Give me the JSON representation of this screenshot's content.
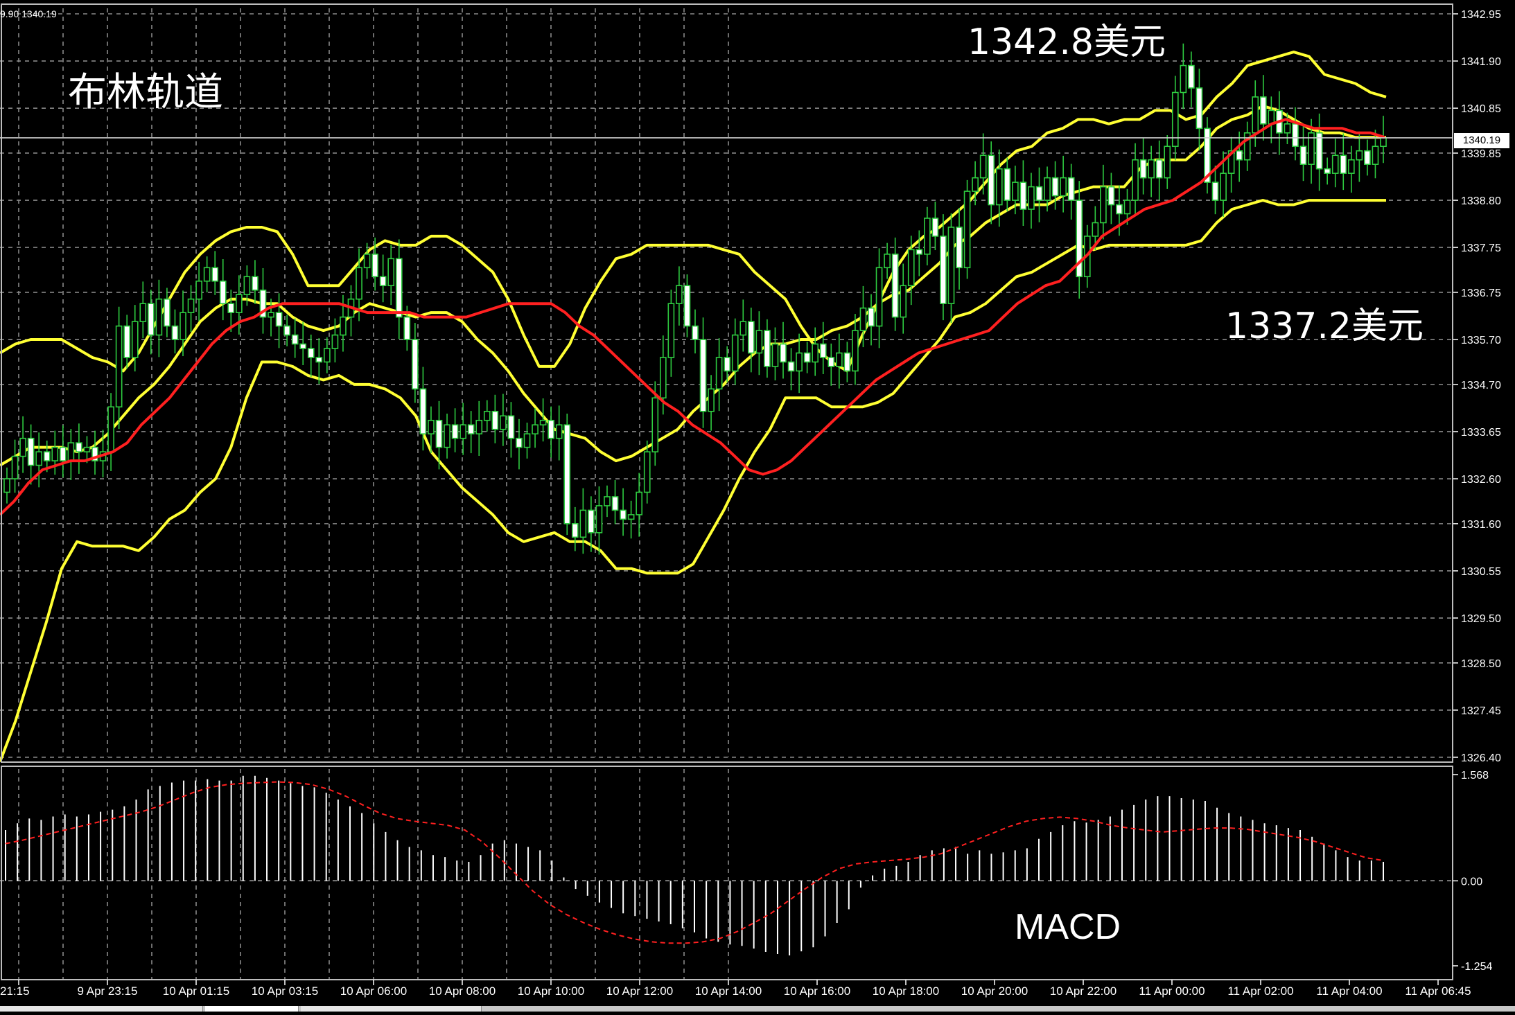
{
  "title": "布林轨道",
  "ohlc_readout": "9.90 1340.19",
  "annotations": {
    "high": "1342.8美元",
    "low": "1337.2美元",
    "macd": "MACD"
  },
  "current_price_label": "1340.19",
  "colors": {
    "background": "#000000",
    "grid": "#8a8a8a",
    "bullish": "#2ecc40",
    "bearish": "#ffffff",
    "band": "#ffff33",
    "ma": "#ff2020",
    "macd_signal": "#ff2020",
    "macd_hist": "#ffffff"
  },
  "chart_data": [
    {
      "type": "candlestick",
      "title": "布林轨道",
      "x_ticks": [
        "21:15",
        "9 Apr 23:15",
        "10 Apr 01:15",
        "10 Apr 03:15",
        "10 Apr 06:00",
        "10 Apr 08:00",
        "10 Apr 10:00",
        "10 Apr 12:00",
        "10 Apr 14:00",
        "10 Apr 16:00",
        "10 Apr 18:00",
        "10 Apr 20:00",
        "10 Apr 22:00",
        "11 Apr 00:00",
        "11 Apr 02:00",
        "11 Apr 04:00",
        "11 Apr 06:45"
      ],
      "y_ticks": [
        "1342.95",
        "1341.90",
        "1340.85",
        "1339.85",
        "1338.80",
        "1337.75",
        "1336.75",
        "1335.70",
        "1334.70",
        "1333.65",
        "1332.60",
        "1331.60",
        "1330.55",
        "1329.50",
        "1328.50",
        "1327.45",
        "1326.40"
      ],
      "ylim": [
        1326.4,
        1342.95
      ],
      "current_price": 1340.19,
      "closes": [
        1332.6,
        1333.1,
        1333.5,
        1332.9,
        1333.2,
        1333.0,
        1333.3,
        1333.0,
        1333.4,
        1333.2,
        1333.3,
        1333.0,
        1333.2,
        1334.2,
        1336.0,
        1335.3,
        1336.1,
        1336.5,
        1335.8,
        1336.6,
        1336.0,
        1335.7,
        1336.3,
        1336.6,
        1337.0,
        1337.3,
        1337.0,
        1336.5,
        1336.3,
        1336.7,
        1337.1,
        1336.8,
        1336.2,
        1336.3,
        1336.0,
        1335.8,
        1335.6,
        1335.5,
        1335.3,
        1335.2,
        1335.5,
        1335.8,
        1336.2,
        1336.6,
        1337.3,
        1337.6,
        1337.1,
        1336.9,
        1337.5,
        1336.2,
        1335.7,
        1334.6,
        1333.6,
        1333.9,
        1333.3,
        1333.8,
        1333.5,
        1333.8,
        1333.6,
        1333.9,
        1334.1,
        1333.7,
        1334.0,
        1333.5,
        1333.3,
        1333.6,
        1333.8,
        1333.9,
        1333.5,
        1333.8,
        1331.6,
        1331.3,
        1331.9,
        1331.4,
        1332.0,
        1332.2,
        1331.9,
        1331.7,
        1331.8,
        1332.3,
        1333.2,
        1334.4,
        1335.3,
        1336.5,
        1336.9,
        1336.0,
        1335.7,
        1334.1,
        1334.6,
        1335.3,
        1335.0,
        1335.8,
        1336.1,
        1335.4,
        1335.9,
        1335.1,
        1335.6,
        1335.2,
        1335.0,
        1335.4,
        1335.2,
        1335.6,
        1335.3,
        1335.1,
        1335.4,
        1335.0,
        1335.9,
        1336.4,
        1336.0,
        1337.3,
        1337.6,
        1336.2,
        1336.9,
        1337.7,
        1337.6,
        1338.4,
        1338.0,
        1336.5,
        1338.2,
        1337.3,
        1339.0,
        1339.3,
        1339.8,
        1338.7,
        1339.5,
        1338.8,
        1339.2,
        1338.6,
        1339.1,
        1338.8,
        1339.3,
        1338.9,
        1339.3,
        1338.8,
        1337.1,
        1338.0,
        1338.3,
        1339.1,
        1338.7,
        1338.5,
        1338.8,
        1339.7,
        1339.3,
        1339.7,
        1339.3,
        1340.0,
        1341.2,
        1341.8,
        1341.3,
        1340.4,
        1339.2,
        1338.8,
        1339.4,
        1339.9,
        1339.7,
        1340.3,
        1341.1,
        1340.5,
        1340.8,
        1340.3,
        1340.5,
        1340.0,
        1339.6,
        1340.3,
        1339.5,
        1339.4,
        1339.8,
        1339.4,
        1339.7,
        1339.9,
        1339.6,
        1340.0,
        1340.19
      ],
      "bands": {
        "upper": [
          1335.4,
          1335.6,
          1335.7,
          1335.7,
          1335.7,
          1335.5,
          1335.3,
          1335.2,
          1335.0,
          1335.4,
          1336.0,
          1336.6,
          1337.2,
          1337.6,
          1337.9,
          1338.1,
          1338.2,
          1338.2,
          1338.1,
          1337.6,
          1336.9,
          1336.9,
          1336.9,
          1337.3,
          1337.7,
          1337.9,
          1337.8,
          1337.8,
          1338.0,
          1338.0,
          1337.8,
          1337.5,
          1337.2,
          1336.6,
          1335.8,
          1335.1,
          1335.1,
          1335.6,
          1336.4,
          1337.0,
          1337.5,
          1337.6,
          1337.8,
          1337.8,
          1337.8,
          1337.8,
          1337.8,
          1337.7,
          1337.6,
          1337.2,
          1336.9,
          1336.6,
          1336.0,
          1335.5,
          1335.2,
          1335.0,
          1335.8,
          1336.5,
          1337.2,
          1337.7,
          1338.0,
          1338.2,
          1338.5,
          1338.8,
          1339.2,
          1339.6,
          1339.9,
          1340.0,
          1340.3,
          1340.4,
          1340.6,
          1340.6,
          1340.5,
          1340.6,
          1340.6,
          1340.8,
          1340.8,
          1340.6,
          1340.7,
          1341.1,
          1341.4,
          1341.8,
          1341.9,
          1342.0,
          1342.1,
          1342.0,
          1341.6,
          1341.5,
          1341.4,
          1341.2,
          1341.1
        ],
        "middle": [
          1332.9,
          1333.1,
          1333.3,
          1333.3,
          1333.3,
          1333.2,
          1333.3,
          1333.6,
          1334.0,
          1334.4,
          1334.7,
          1335.1,
          1335.6,
          1336.1,
          1336.4,
          1336.6,
          1336.6,
          1336.5,
          1336.5,
          1336.2,
          1336.0,
          1335.9,
          1336.0,
          1336.3,
          1336.5,
          1336.4,
          1336.3,
          1336.2,
          1336.3,
          1336.3,
          1336.1,
          1335.7,
          1335.4,
          1335.0,
          1334.5,
          1334.1,
          1333.7,
          1333.6,
          1333.5,
          1333.2,
          1333.0,
          1333.1,
          1333.3,
          1333.5,
          1333.7,
          1334.1,
          1334.4,
          1334.7,
          1335.1,
          1335.4,
          1335.6,
          1335.6,
          1335.7,
          1335.7,
          1335.9,
          1336.0,
          1336.2,
          1336.5,
          1336.7,
          1336.8,
          1337.1,
          1337.4,
          1337.8,
          1338.0,
          1338.3,
          1338.5,
          1338.7,
          1338.7,
          1338.7,
          1338.9,
          1339.0,
          1339.1,
          1339.1,
          1339.1,
          1339.5,
          1339.7,
          1339.7,
          1339.7,
          1340.0,
          1340.4,
          1340.6,
          1340.7,
          1340.9,
          1340.8,
          1340.6,
          1340.4,
          1340.3,
          1340.3,
          1340.2,
          1340.2,
          1340.2
        ],
        "lower": [
          1326.3,
          1327.2,
          1328.3,
          1329.4,
          1330.6,
          1331.2,
          1331.1,
          1331.1,
          1331.1,
          1331.0,
          1331.3,
          1331.7,
          1331.9,
          1332.3,
          1332.6,
          1333.3,
          1334.4,
          1335.2,
          1335.2,
          1335.1,
          1334.9,
          1334.8,
          1334.9,
          1334.7,
          1334.7,
          1334.6,
          1334.4,
          1334.0,
          1333.2,
          1332.8,
          1332.4,
          1332.1,
          1331.8,
          1331.4,
          1331.2,
          1331.3,
          1331.4,
          1331.2,
          1331.2,
          1331.0,
          1330.6,
          1330.6,
          1330.5,
          1330.5,
          1330.5,
          1330.7,
          1331.3,
          1331.9,
          1332.6,
          1333.2,
          1333.7,
          1334.4,
          1334.4,
          1334.4,
          1334.2,
          1334.2,
          1334.2,
          1334.3,
          1334.5,
          1334.9,
          1335.3,
          1335.7,
          1336.2,
          1336.3,
          1336.5,
          1336.8,
          1337.1,
          1337.2,
          1337.4,
          1337.6,
          1337.8,
          1337.7,
          1337.8,
          1337.8,
          1337.8,
          1337.8,
          1337.8,
          1337.8,
          1337.9,
          1338.3,
          1338.6,
          1338.7,
          1338.8,
          1338.7,
          1338.7,
          1338.8,
          1338.8,
          1338.8,
          1338.8,
          1338.8,
          1338.8
        ]
      },
      "ma": [
        1331.8,
        1332.1,
        1332.5,
        1332.8,
        1332.9,
        1333.0,
        1333.0,
        1333.1,
        1333.2,
        1333.4,
        1333.8,
        1334.1,
        1334.4,
        1334.8,
        1335.2,
        1335.6,
        1335.9,
        1336.1,
        1336.2,
        1336.4,
        1336.5,
        1336.5,
        1336.5,
        1336.5,
        1336.5,
        1336.4,
        1336.3,
        1336.3,
        1336.3,
        1336.3,
        1336.2,
        1336.2,
        1336.2,
        1336.2,
        1336.3,
        1336.4,
        1336.5,
        1336.5,
        1336.5,
        1336.5,
        1336.3,
        1336.0,
        1335.8,
        1335.5,
        1335.2,
        1334.9,
        1334.6,
        1334.3,
        1334.1,
        1333.8,
        1333.6,
        1333.4,
        1333.1,
        1332.8,
        1332.7,
        1332.8,
        1333.0,
        1333.3,
        1333.6,
        1333.9,
        1334.2,
        1334.5,
        1334.8,
        1335.0,
        1335.2,
        1335.4,
        1335.5,
        1335.6,
        1335.7,
        1335.8,
        1335.9,
        1336.2,
        1336.5,
        1336.7,
        1336.9,
        1337.0,
        1337.3,
        1337.6,
        1338.0,
        1338.2,
        1338.4,
        1338.6,
        1338.7,
        1338.8,
        1339.0,
        1339.2,
        1339.5,
        1339.8,
        1340.1,
        1340.3,
        1340.5,
        1340.6,
        1340.5,
        1340.4,
        1340.4,
        1340.4,
        1340.3,
        1340.3,
        1340.2
      ]
    },
    {
      "type": "bar",
      "title": "MACD",
      "y_ticks": [
        "1.568",
        "0.00",
        "-1.254"
      ],
      "ylim": [
        -1.254,
        1.568
      ],
      "histogram": [
        0.75,
        0.85,
        0.92,
        0.9,
        0.95,
        0.98,
        0.95,
        0.98,
        1.02,
        1.05,
        1.1,
        1.2,
        1.35,
        1.4,
        1.45,
        1.48,
        1.48,
        1.5,
        1.48,
        1.48,
        1.55,
        1.55,
        1.52,
        1.48,
        1.44,
        1.4,
        1.38,
        1.3,
        1.2,
        1.1,
        1.0,
        0.85,
        0.72,
        0.6,
        0.5,
        0.45,
        0.38,
        0.35,
        0.3,
        0.28,
        0.38,
        0.55,
        0.6,
        0.55,
        0.5,
        0.45,
        0.3,
        0.05,
        -0.12,
        -0.22,
        -0.32,
        -0.4,
        -0.48,
        -0.52,
        -0.56,
        -0.6,
        -0.64,
        -0.7,
        -0.76,
        -0.85,
        -0.9,
        -0.94,
        -0.96,
        -1.0,
        -1.05,
        -1.08,
        -1.1,
        -1.04,
        -0.98,
        -0.82,
        -0.62,
        -0.42,
        -0.1,
        0.08,
        0.18,
        0.22,
        0.28,
        0.38,
        0.45,
        0.48,
        0.5,
        0.4,
        0.45,
        0.4,
        0.42,
        0.45,
        0.48,
        0.62,
        0.72,
        0.82,
        0.88,
        0.86,
        0.9,
        0.95,
        1.05,
        1.12,
        1.2,
        1.25,
        1.25,
        1.22,
        1.2,
        1.18,
        1.08,
        1.0,
        0.95,
        0.9,
        0.85,
        0.82,
        0.78,
        0.75,
        0.65,
        0.55,
        0.45,
        0.35,
        0.3,
        0.3,
        0.28
      ],
      "signal": [
        0.55,
        0.6,
        0.66,
        0.72,
        0.78,
        0.84,
        0.9,
        0.96,
        1.02,
        1.1,
        1.2,
        1.3,
        1.38,
        1.42,
        1.44,
        1.45,
        1.46,
        1.45,
        1.42,
        1.35,
        1.25,
        1.12,
        1.0,
        0.92,
        0.88,
        0.85,
        0.82,
        0.75,
        0.58,
        0.35,
        0.1,
        -0.15,
        -0.35,
        -0.5,
        -0.62,
        -0.72,
        -0.8,
        -0.86,
        -0.9,
        -0.92,
        -0.92,
        -0.9,
        -0.85,
        -0.75,
        -0.62,
        -0.48,
        -0.3,
        -0.12,
        0.05,
        0.18,
        0.25,
        0.28,
        0.3,
        0.32,
        0.35,
        0.4,
        0.5,
        0.6,
        0.7,
        0.8,
        0.88,
        0.92,
        0.94,
        0.92,
        0.88,
        0.82,
        0.78,
        0.75,
        0.72,
        0.74,
        0.76,
        0.78,
        0.78,
        0.76,
        0.72,
        0.68,
        0.64,
        0.58,
        0.5,
        0.42,
        0.34,
        0.3
      ]
    }
  ]
}
